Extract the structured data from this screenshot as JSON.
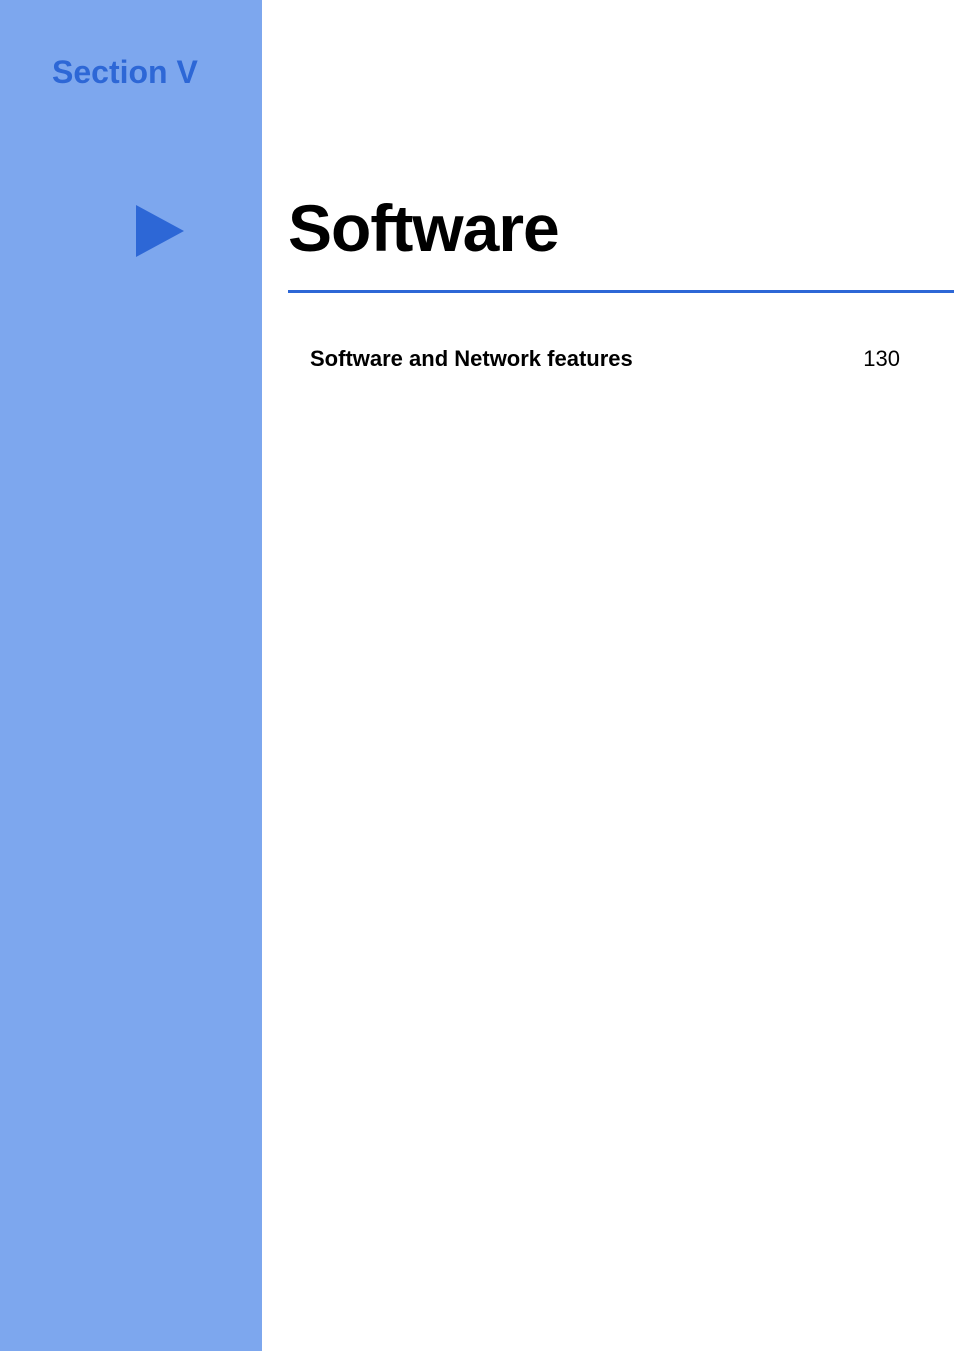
{
  "section_label": "Section V",
  "main_title": "Software",
  "toc": {
    "entry_title": "Software and Network features",
    "entry_page": "130"
  }
}
